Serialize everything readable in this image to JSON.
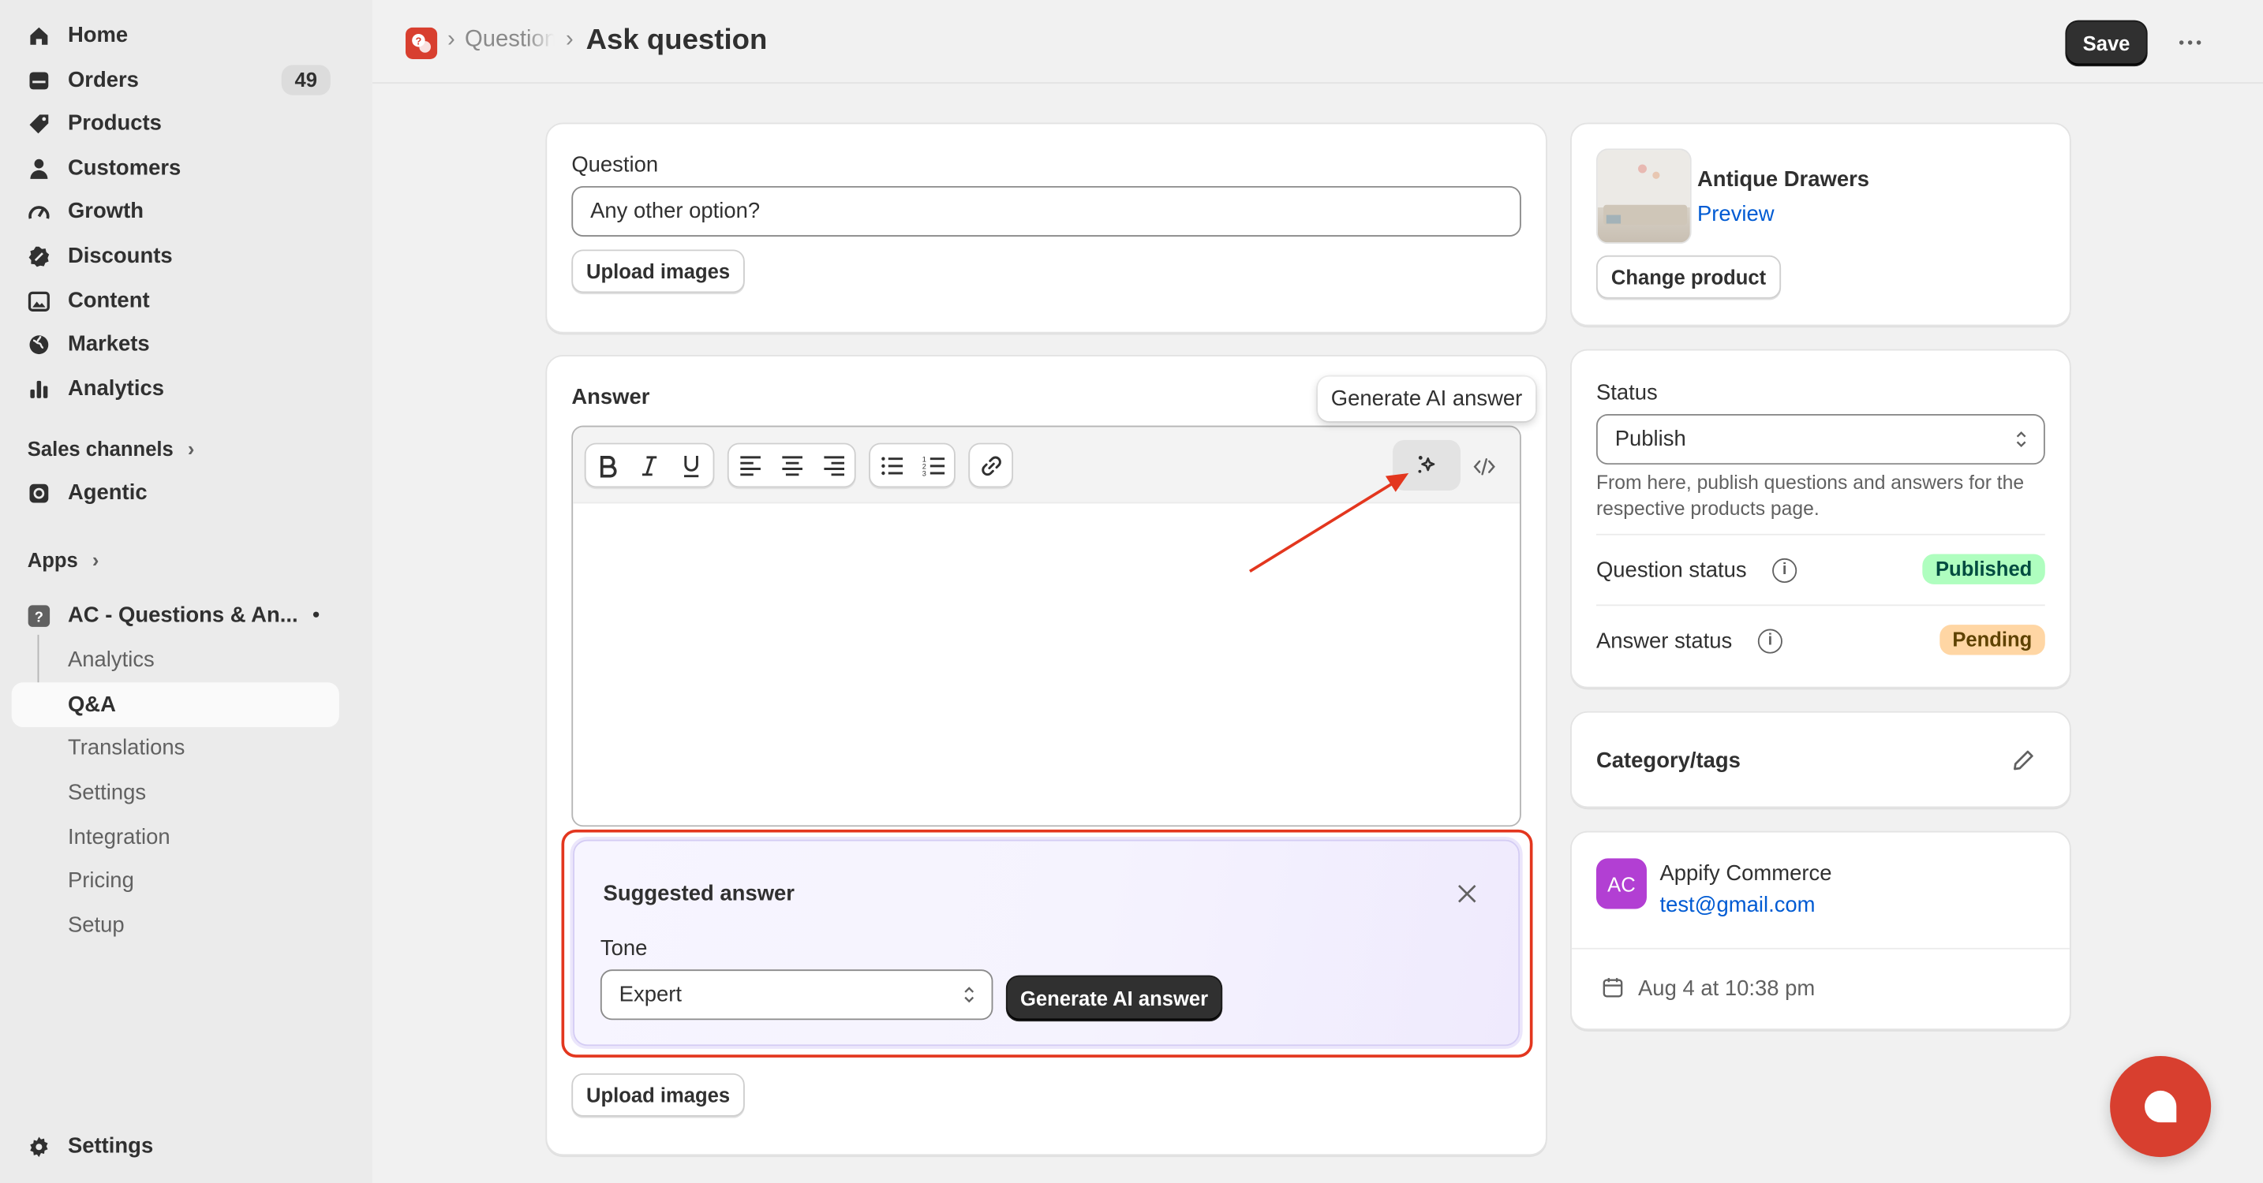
{
  "sidebar": {
    "items": [
      {
        "label": "Home",
        "icon": "home-icon"
      },
      {
        "label": "Orders",
        "icon": "orders-icon",
        "badge": "49"
      },
      {
        "label": "Products",
        "icon": "tag-icon"
      },
      {
        "label": "Customers",
        "icon": "person-icon"
      },
      {
        "label": "Growth",
        "icon": "gauge-icon"
      },
      {
        "label": "Discounts",
        "icon": "discount-icon"
      },
      {
        "label": "Content",
        "icon": "image-icon"
      },
      {
        "label": "Markets",
        "icon": "globe-icon"
      },
      {
        "label": "Analytics",
        "icon": "bar-chart-icon"
      }
    ],
    "sales_channels": "Sales channels",
    "agentic": "Agentic",
    "apps": "Apps",
    "app_name": "AC - Questions & An...",
    "app_sub": [
      "Analytics",
      "Q&A",
      "Translations",
      "Settings",
      "Integration",
      "Pricing",
      "Setup"
    ],
    "settings": "Settings"
  },
  "header": {
    "breadcrumb_parent": "Questions",
    "title": "Ask question",
    "save_label": "Save"
  },
  "question_card": {
    "label": "Question",
    "value": "Any other option?",
    "upload_label": "Upload images"
  },
  "answer_card": {
    "label": "Answer",
    "tooltip": "Generate AI answer",
    "upload_label": "Upload images",
    "suggested": {
      "title": "Suggested answer",
      "tone_label": "Tone",
      "tone_value": "Expert",
      "generate_label": "Generate AI answer"
    }
  },
  "product_card": {
    "name": "Antique Drawers",
    "preview": "Preview",
    "change": "Change product"
  },
  "status_card": {
    "label": "Status",
    "value": "Publish",
    "help": "From here, publish questions and answers for the respective products page.",
    "question_status_label": "Question status",
    "question_status": "Published",
    "answer_status_label": "Answer status",
    "answer_status": "Pending"
  },
  "category_card": {
    "title": "Category/tags"
  },
  "customer_card": {
    "initials": "AC",
    "name": "Appify Commerce",
    "email": "test@gmail.com",
    "date": "Aug 4 at 10:38 pm"
  },
  "colors": {
    "accent_link": "#005bd3",
    "published_bg": "#affebf",
    "pending_bg": "#ffd6a4",
    "highlight_border": "#e3361e",
    "chat_button": "#d83f2f",
    "avatar_bg": "#b23fd3"
  }
}
